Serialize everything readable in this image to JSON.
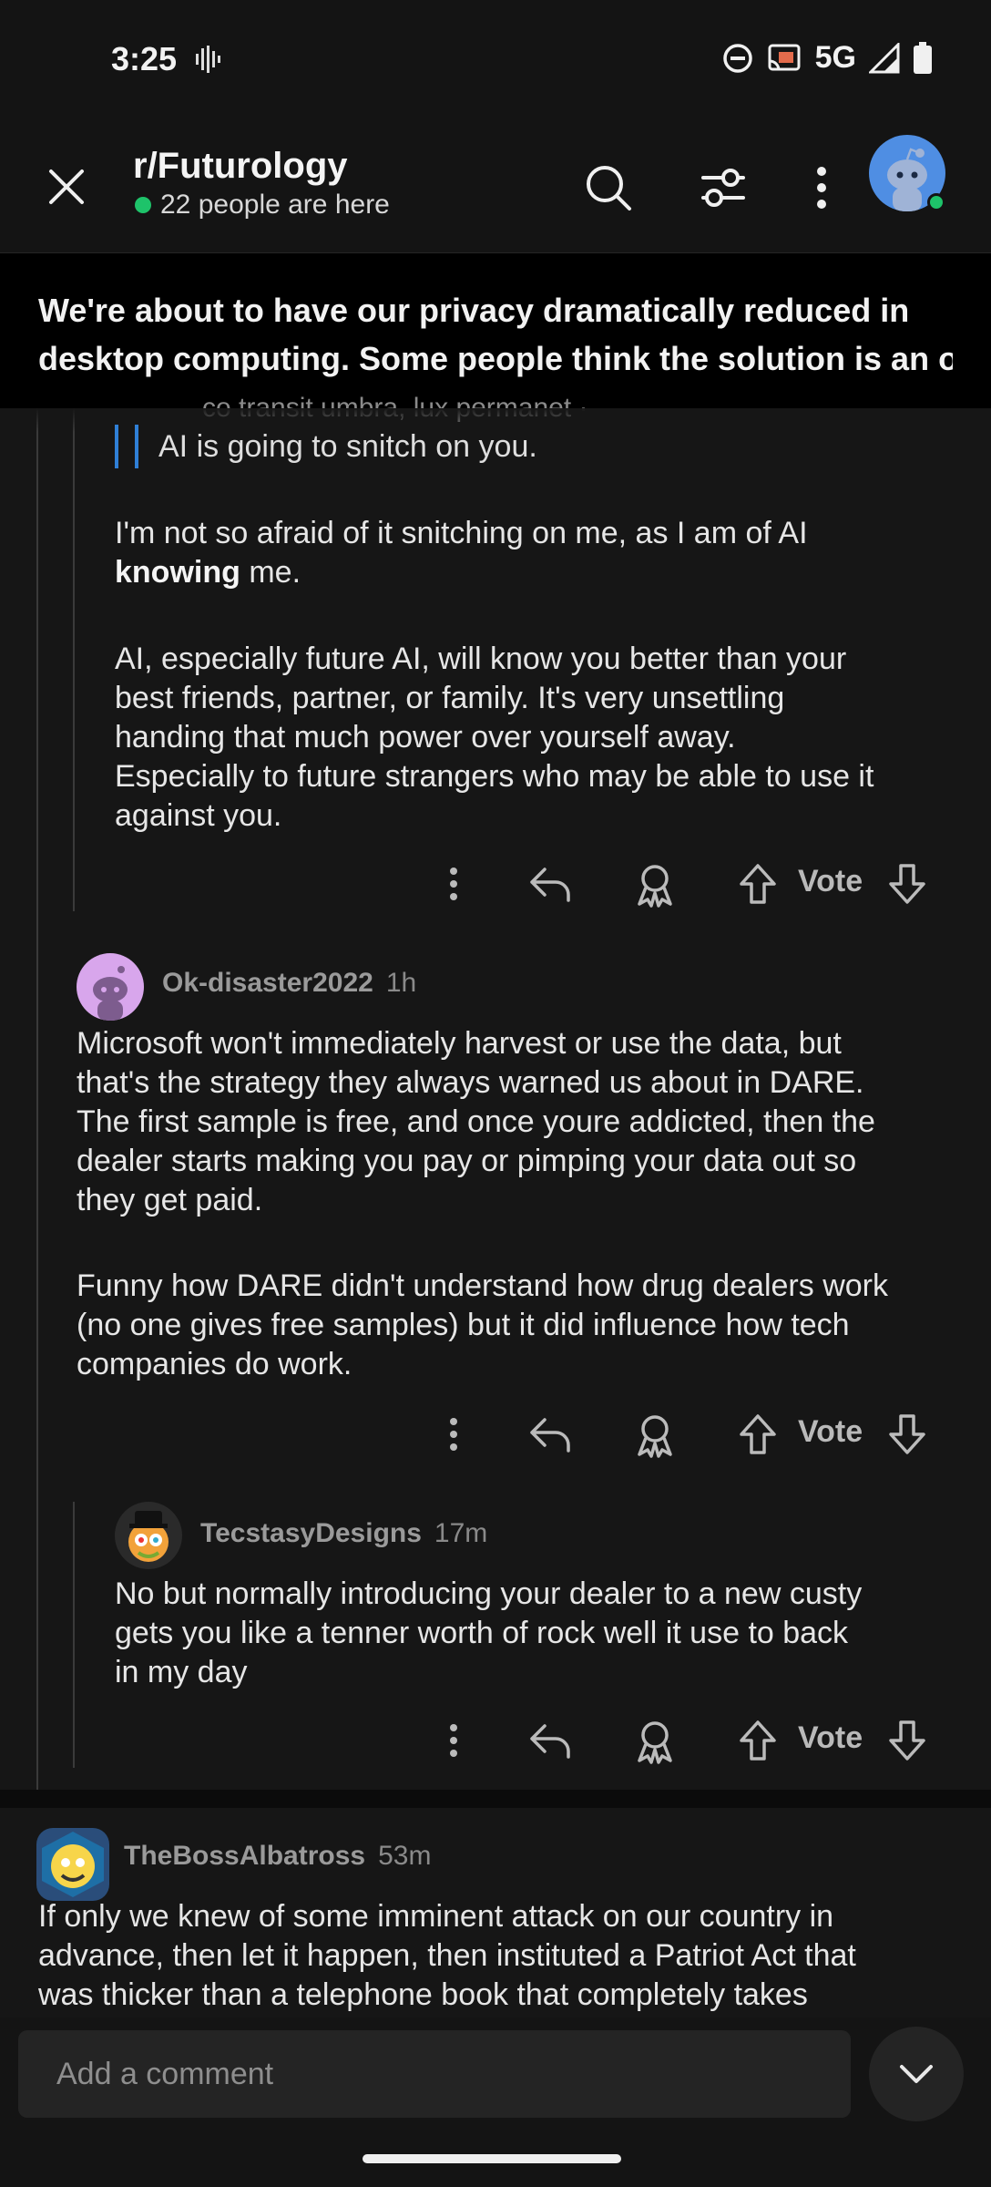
{
  "status_bar": {
    "time": "3:25",
    "network": "5G"
  },
  "header": {
    "subreddit": "r/Futurology",
    "online_text": "22 people are here"
  },
  "post_banner": {
    "line1": "We're about to have our privacy dramatically reduced in",
    "line2": "desktop computing. Some people think the solution is an op..."
  },
  "comments": [
    {
      "partial_meta": "co transit umbra, lux permanet ·",
      "quote": "AI is going to snitch on you.",
      "para1_prefix": "I'm not so afraid of it snitching on me, as I am of AI",
      "para1_bold": "knowing",
      "para1_suffix": " me.",
      "para2_lines": [
        "AI, especially future AI, will know you better than your",
        "best friends, partner, or family. It's very unsettling",
        "handing that much power over yourself away.",
        "Especially to future strangers who may be able to use it",
        "against you."
      ],
      "vote_label": "Vote"
    },
    {
      "author": "Ok-disaster2022",
      "age": "1h",
      "para1_lines": [
        "Microsoft won't immediately harvest or use the data, but",
        "that's the strategy they always warned us about in DARE.",
        "The first sample is free, and once youre addicted, then the",
        "dealer starts making you pay or pimping your data out so",
        "they get paid."
      ],
      "para2_lines": [
        "Funny how DARE didn't understand how drug dealers work",
        "(no one gives free samples) but it did influence how tech",
        "companies do work."
      ],
      "vote_label": "Vote"
    },
    {
      "author": "TecstasyDesigns",
      "age": "17m",
      "lines": [
        "No but normally introducing your dealer to a new custy",
        "gets you like a tenner worth of rock well it use to back",
        "in my day"
      ],
      "vote_label": "Vote"
    },
    {
      "author": "TheBossAlbatross",
      "age": "53m",
      "lines": [
        "If only we knew of some imminent attack on our country in",
        "advance, then let it happen, then instituted a Patriot Act that",
        "was thicker than a telephone book that completely takes"
      ]
    }
  ],
  "composer": {
    "placeholder": "Add a comment"
  },
  "icons": {
    "close": "close-icon",
    "search": "search-icon",
    "filter": "filter-icon",
    "more": "more-vertical-icon",
    "reply": "reply-icon",
    "award": "award-icon",
    "upvote": "upvote-icon",
    "downvote": "downvote-icon",
    "collapse": "chevron-down-icon"
  },
  "colors": {
    "accent_quote": "#2f7fd6",
    "online": "#1ec36a",
    "background": "#161616"
  }
}
